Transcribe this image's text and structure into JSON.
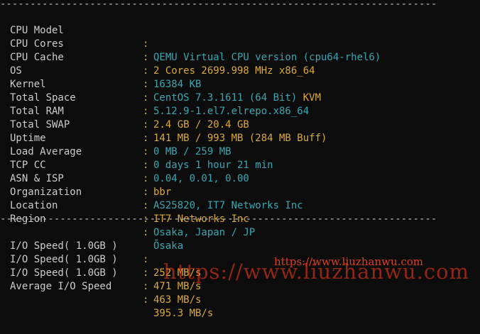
{
  "divider": "-------------------------------------------------------------------------",
  "rows": [
    {
      "label": "CPU Model",
      "value": "QEMU Virtual CPU version (cpu64-rhel6)"
    },
    {
      "label": "CPU Cores",
      "value": "2 Cores 2699.998 MHz x86_64"
    },
    {
      "label": "CPU Cache",
      "value": "16384 KB"
    },
    {
      "label": "OS",
      "value": "CentOS 7.3.1611 (64 Bit)",
      "extra": "KVM"
    },
    {
      "label": "Kernel",
      "value": "5.12.9-1.el7.elrepo.x86_64"
    },
    {
      "label": "Total Space",
      "value": "2.4 GB / 20.4 GB"
    },
    {
      "label": "Total RAM",
      "value": "141 MB / 993 MB (284 MB Buff)"
    },
    {
      "label": "Total SWAP",
      "value": "0 MB / 259 MB"
    },
    {
      "label": "Uptime",
      "value": "0 days 1 hour 21 min"
    },
    {
      "label": "Load Average",
      "value": "0.04, 0.01, 0.00"
    },
    {
      "label": "TCP CC",
      "value": "bbr"
    },
    {
      "label": "ASN & ISP",
      "value": "AS25820, IT7 Networks Inc"
    },
    {
      "label": "Organization",
      "value": "IT7 Networks Inc"
    },
    {
      "label": "Location",
      "value": "Osaka, Japan / JP"
    },
    {
      "label": "Region",
      "value": "Ōsaka"
    }
  ],
  "io": [
    {
      "label": "I/O Speed( 1.0GB )",
      "value": "252 MB/s"
    },
    {
      "label": "I/O Speed( 1.0GB )",
      "value": "471 MB/s"
    },
    {
      "label": "I/O Speed( 1.0GB )",
      "value": "463 MB/s"
    },
    {
      "label": "Average I/O Speed",
      "value": "395.3 MB/s"
    }
  ],
  "separator": ":",
  "watermark": {
    "small": "https://www.liuzhanwu.com",
    "big": "https://www.liuzhanwu.com"
  },
  "colors": {
    "background": "#0c0c0c",
    "label": "#cccccc",
    "teal_value": "#3aa6b1",
    "orange_value": "#d9a93a",
    "watermark": "#ff3b1f"
  }
}
